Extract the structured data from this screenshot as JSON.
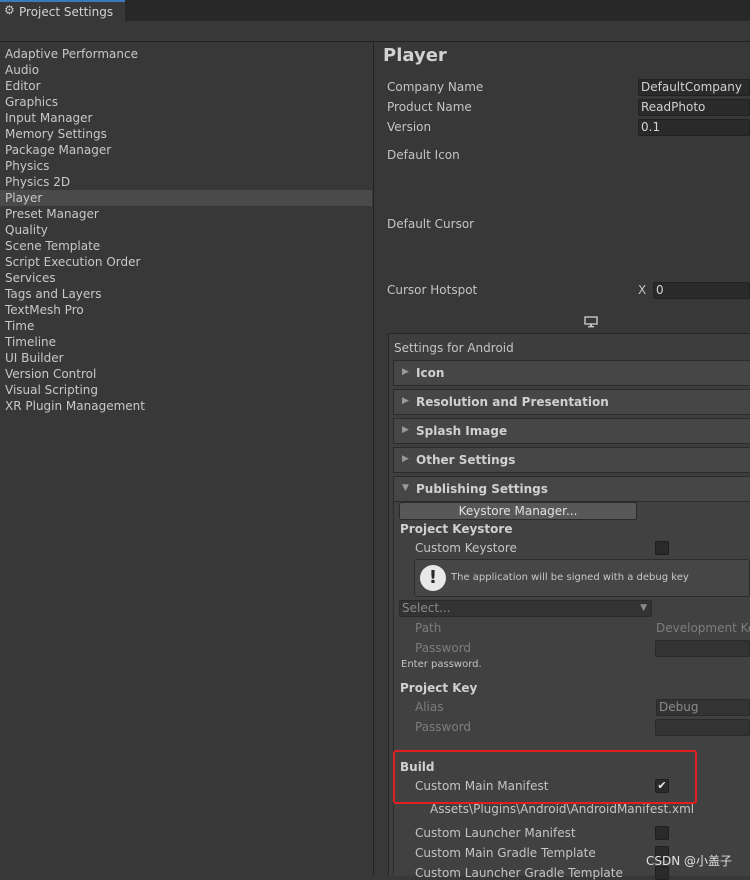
{
  "window": {
    "tab_title": "Project Settings",
    "tab_icon": "gear-icon"
  },
  "sidebar": {
    "items": [
      "Adaptive Performance",
      "Audio",
      "Editor",
      "Graphics",
      "Input Manager",
      "Memory Settings",
      "Package Manager",
      "Physics",
      "Physics 2D",
      "Player",
      "Preset Manager",
      "Quality",
      "Scene Template",
      "Script Execution Order",
      "Services",
      "Tags and Layers",
      "TextMesh Pro",
      "Time",
      "Timeline",
      "UI Builder",
      "Version Control",
      "Visual Scripting",
      "XR Plugin Management"
    ],
    "selected": "Player"
  },
  "player": {
    "title": "Player",
    "company_label": "Company Name",
    "company_value": "DefaultCompany",
    "product_label": "Product Name",
    "product_value": "ReadPhoto",
    "version_label": "Version",
    "version_value": "0.1",
    "default_icon_label": "Default Icon",
    "default_cursor_label": "Default Cursor",
    "cursor_hotspot_label": "Cursor Hotspot",
    "cursor_hotspot_x_label": "X",
    "cursor_hotspot_x_value": "0"
  },
  "platform": {
    "icon": "monitor-icon",
    "settings_title": "Settings for Android",
    "sections": [
      "Icon",
      "Resolution and Presentation",
      "Splash Image",
      "Other Settings"
    ],
    "publishing_title": "Publishing Settings"
  },
  "publishing": {
    "keystore_manager_button": "Keystore Manager...",
    "project_keystore_header": "Project Keystore",
    "custom_keystore_label": "Custom Keystore",
    "custom_keystore_checked": false,
    "helpbox_text": "The application will be signed with a debug key",
    "select_placeholder": "Select...",
    "path_label": "Path",
    "path_value": "Development Ke",
    "password_label": "Password",
    "enter_password_hint": "Enter password.",
    "project_key_header": "Project Key",
    "alias_label": "Alias",
    "alias_value": "Debug",
    "key_password_label": "Password"
  },
  "build": {
    "header": "Build",
    "custom_main_manifest_label": "Custom Main Manifest",
    "custom_main_manifest_checked": true,
    "manifest_path": "Assets\\Plugins\\Android\\AndroidManifest.xml",
    "custom_launcher_manifest_label": "Custom Launcher Manifest",
    "custom_main_gradle_label": "Custom Main Gradle Template",
    "custom_launcher_gradle_label": "Custom Launcher Gradle Template",
    "check_mark": "✔"
  },
  "watermark": "CSDN @小盖子",
  "colors": {
    "highlight_box": "#e02020",
    "tab_accent": "#3a79bb"
  }
}
